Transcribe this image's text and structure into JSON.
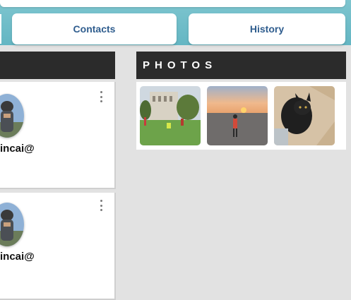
{
  "nav": {
    "contacts_label": "Contacts",
    "history_label": "History"
  },
  "photos": {
    "heading": "PHOTOS"
  },
  "contacts": [
    {
      "email_fragment": "incai@"
    },
    {
      "email_fragment": "incai@"
    }
  ],
  "colors": {
    "header_teal": "#6dbcc8",
    "nav_text": "#2f5d8e",
    "section_band": "#2b2b2b",
    "page_background": "#e2e2e2"
  }
}
